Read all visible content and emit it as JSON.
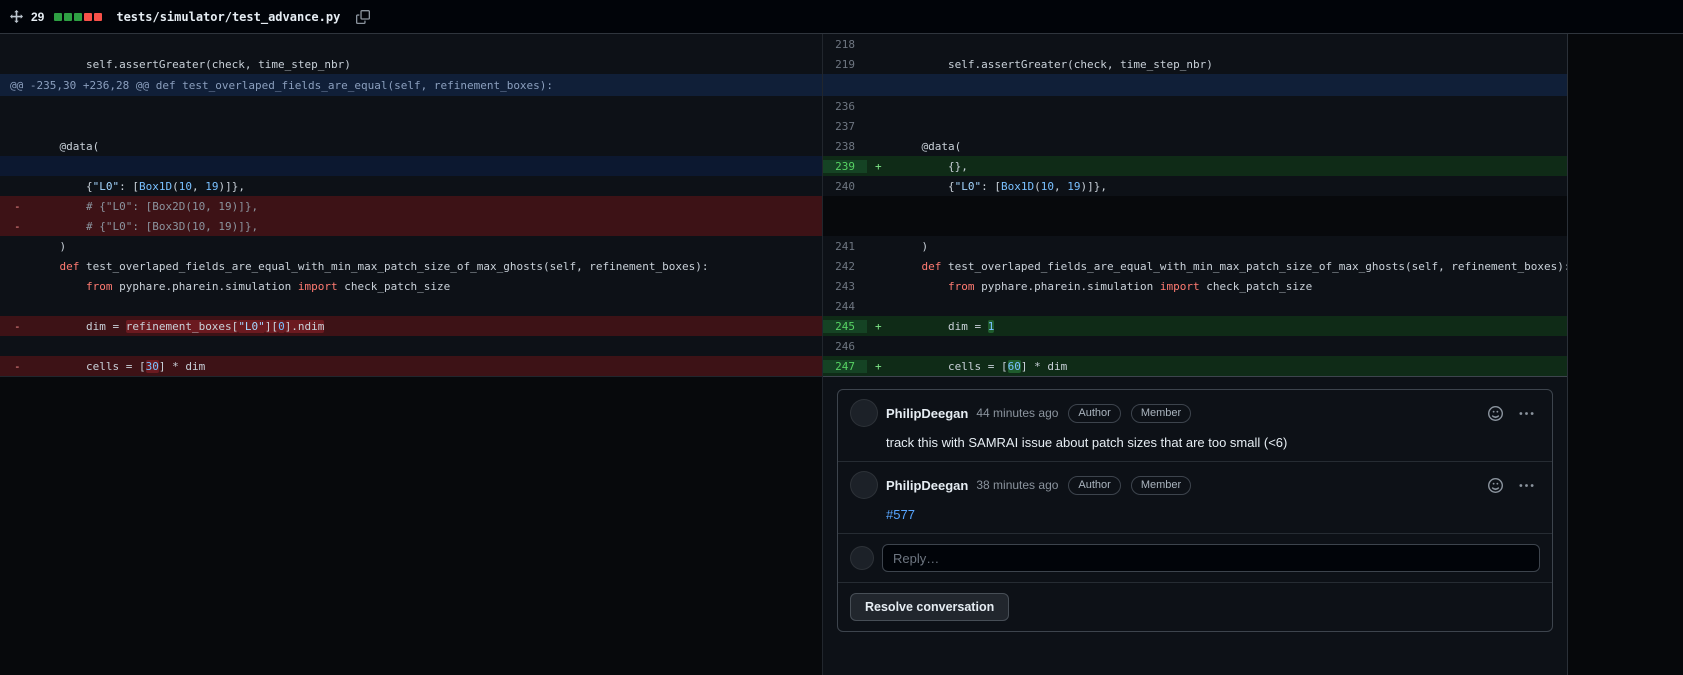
{
  "header": {
    "lines_changed": "29",
    "diffstat": [
      "#2ea043",
      "#2ea043",
      "#2ea043",
      "#f85149",
      "#f85149"
    ],
    "file_path": "tests/simulator/test_advance.py"
  },
  "icons": {
    "drag_handle": "move-icon",
    "copy": "copy-icon",
    "emoji": "smiley-icon",
    "more": "kebab-menu-icon"
  },
  "colors": {
    "addition": "#3fb950",
    "deletion": "#f85149",
    "link": "#58a6ff",
    "addition_line_bg": "#0f2b17",
    "deletion_line_bg": "#3d1216",
    "addition_word_bg": "#1f5c2d",
    "deletion_word_bg": "#6b1a20",
    "hunk_bg": "#101f38"
  },
  "diff": {
    "hunk_header": "@@ -235,30 +236,28 @@ def test_overlaped_fields_are_equal(self, refinement_boxes):",
    "rows": [
      {
        "l": {
          "k": "ctx",
          "segs": []
        },
        "r": {
          "k": "ctx",
          "num": "218",
          "segs": []
        }
      },
      {
        "l": {
          "k": "ctx",
          "segs": [
            {
              "t": "        self.assertGreater(check, time_step_nbr)"
            }
          ]
        },
        "r": {
          "k": "ctx",
          "num": "219",
          "segs": [
            {
              "t": "        self.assertGreater(check, time_step_nbr)"
            }
          ]
        }
      },
      {
        "l": {
          "k": "hunk",
          "t": "@@ -235,30 +236,28 @@ def test_overlaped_fields_are_equal(self, refinement_boxes):"
        },
        "r": {
          "k": "hunk"
        }
      },
      {
        "l": {
          "k": "ctx",
          "segs": []
        },
        "r": {
          "k": "ctx",
          "num": "236",
          "segs": []
        }
      },
      {
        "l": {
          "k": "ctx",
          "segs": []
        },
        "r": {
          "k": "ctx",
          "num": "237",
          "segs": []
        }
      },
      {
        "l": {
          "k": "ctx",
          "segs": [
            {
              "t": "    @data("
            }
          ]
        },
        "r": {
          "k": "ctx",
          "num": "238",
          "segs": [
            {
              "t": "    @data("
            }
          ]
        }
      },
      {
        "l": {
          "k": "empty"
        },
        "r": {
          "k": "add",
          "num": "239",
          "sign": "+",
          "segs": [
            {
              "t": "        {},"
            }
          ]
        }
      },
      {
        "l": {
          "k": "ctx",
          "segs": [
            {
              "t": "        {"
            },
            {
              "t": "\"L0\"",
              "c": "s"
            },
            {
              "t": ": ["
            },
            {
              "t": "Box1D",
              "c": "n"
            },
            {
              "t": "("
            },
            {
              "t": "10",
              "c": "n"
            },
            {
              "t": ", "
            },
            {
              "t": "19",
              "c": "n"
            },
            {
              "t": ")]},"
            }
          ]
        },
        "r": {
          "k": "ctx",
          "num": "240",
          "segs": [
            {
              "t": "        {"
            },
            {
              "t": "\"L0\"",
              "c": "s"
            },
            {
              "t": ": ["
            },
            {
              "t": "Box1D",
              "c": "n"
            },
            {
              "t": "("
            },
            {
              "t": "10",
              "c": "n"
            },
            {
              "t": ", "
            },
            {
              "t": "19",
              "c": "n"
            },
            {
              "t": ")]},"
            }
          ]
        }
      },
      {
        "l": {
          "k": "del",
          "sign": "-",
          "segs": [
            {
              "t": "        # {\"L0\": [Box2D(10, 19)]},",
              "c": "c"
            }
          ]
        },
        "r": {
          "k": "empty"
        }
      },
      {
        "l": {
          "k": "del",
          "sign": "-",
          "segs": [
            {
              "t": "        # {\"L0\": [Box3D(10, 19)]},",
              "c": "c"
            }
          ]
        },
        "r": {
          "k": "empty"
        }
      },
      {
        "l": {
          "k": "ctx",
          "segs": [
            {
              "t": "    )"
            }
          ]
        },
        "r": {
          "k": "ctx",
          "num": "241",
          "segs": [
            {
              "t": "    )"
            }
          ]
        }
      },
      {
        "l": {
          "k": "ctx",
          "segs": [
            {
              "t": "    "
            },
            {
              "t": "def",
              "c": "kw"
            },
            {
              "t": " test_overlaped_fields_are_equal_with_min_max_patch_size_of_max_ghosts(self, refinement_boxes):"
            }
          ]
        },
        "r": {
          "k": "ctx",
          "num": "242",
          "segs": [
            {
              "t": "    "
            },
            {
              "t": "def",
              "c": "kw"
            },
            {
              "t": " test_overlaped_fields_are_equal_with_min_max_patch_size_of_max_ghosts(self, refinement_boxes):"
            }
          ]
        }
      },
      {
        "l": {
          "k": "ctx",
          "segs": [
            {
              "t": "        "
            },
            {
              "t": "from",
              "c": "kw"
            },
            {
              "t": " pyphare.pharein.simulation "
            },
            {
              "t": "import",
              "c": "kw"
            },
            {
              "t": " check_patch_size"
            }
          ]
        },
        "r": {
          "k": "ctx",
          "num": "243",
          "segs": [
            {
              "t": "        "
            },
            {
              "t": "from",
              "c": "kw"
            },
            {
              "t": " pyphare.pharein.simulation "
            },
            {
              "t": "import",
              "c": "kw"
            },
            {
              "t": " check_patch_size"
            }
          ]
        }
      },
      {
        "l": {
          "k": "ctx",
          "segs": []
        },
        "r": {
          "k": "ctx",
          "num": "244",
          "segs": []
        }
      },
      {
        "l": {
          "k": "del",
          "sign": "-",
          "segs": [
            {
              "t": "        dim = "
            },
            {
              "t": "refinement_boxes[",
              "h": true
            },
            {
              "t": "\"L0\"",
              "c": "s",
              "h": true
            },
            {
              "t": "][",
              "h": true
            },
            {
              "t": "0",
              "c": "n",
              "h": true
            },
            {
              "t": "].ndim",
              "h": true
            }
          ]
        },
        "r": {
          "k": "add",
          "num": "245",
          "sign": "+",
          "segs": [
            {
              "t": "        dim = "
            },
            {
              "t": "1",
              "c": "n",
              "h": true
            }
          ]
        }
      },
      {
        "l": {
          "k": "ctx",
          "segs": []
        },
        "r": {
          "k": "ctx",
          "num": "246",
          "segs": []
        }
      },
      {
        "l": {
          "k": "del",
          "sign": "-",
          "segs": [
            {
              "t": "        cells = ["
            },
            {
              "t": "30",
              "c": "n",
              "h": true
            },
            {
              "t": "] * dim"
            }
          ]
        },
        "r": {
          "k": "add",
          "num": "247",
          "sign": "+",
          "segs": [
            {
              "t": "        cells = ["
            },
            {
              "t": "60",
              "c": "n",
              "h": true
            },
            {
              "t": "] * dim"
            }
          ]
        }
      }
    ]
  },
  "thread": {
    "comments": [
      {
        "author": "PhilipDeegan",
        "time": "44 minutes ago",
        "badges": [
          "Author",
          "Member"
        ],
        "body": "track this with SAMRAI issue about patch sizes that are too small (<6)"
      },
      {
        "author": "PhilipDeegan",
        "time": "38 minutes ago",
        "badges": [
          "Author",
          "Member"
        ],
        "body": "#577"
      }
    ],
    "reply_placeholder": "Reply…",
    "resolve_label": "Resolve conversation"
  }
}
